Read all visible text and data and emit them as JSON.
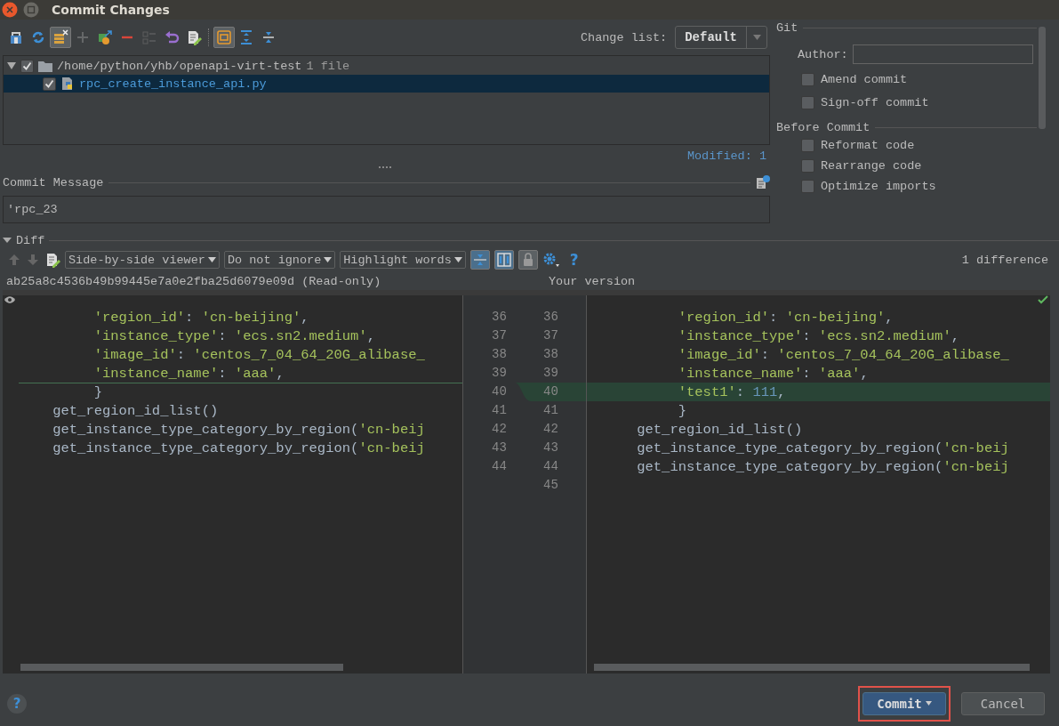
{
  "window": {
    "title": "Commit Changes"
  },
  "toolbar": [
    {
      "selected": false,
      "disabled": false
    },
    {
      "selected": false,
      "disabled": false
    },
    {
      "selected": true,
      "disabled": false
    },
    {
      "selected": false,
      "disabled": true
    },
    {
      "selected": false,
      "disabled": false
    },
    {
      "selected": false,
      "disabled": false
    },
    {
      "selected": false,
      "disabled": true
    },
    {
      "selected": false,
      "disabled": false
    },
    {
      "selected": false,
      "disabled": false
    },
    {
      "selected": true,
      "disabled": false
    },
    {
      "selected": false,
      "disabled": false
    },
    {
      "selected": false,
      "disabled": false
    }
  ],
  "change_list": {
    "label": "Change list:",
    "value": "Default"
  },
  "tree": [
    {
      "label": "/home/python/yhb/openapi-virt-test",
      "count": "1 file",
      "checked": true,
      "expanded": true,
      "selected": false,
      "children": [
        {
          "label": "rpc_create_instance_api.py",
          "checked": true,
          "selected": true
        }
      ]
    }
  ],
  "modified": "Modified: 1",
  "commit_message": {
    "label": "Commit Message",
    "value": "'rpc_23"
  },
  "git": {
    "title": "Git",
    "author_label": "Author:",
    "options": [
      {
        "label": "Amend commit",
        "checked": false
      },
      {
        "label": "Sign-off commit",
        "checked": false
      }
    ]
  },
  "before_commit": {
    "title": "Before Commit",
    "options": [
      {
        "label": "Reformat code",
        "checked": false
      },
      {
        "label": "Rearrange code",
        "checked": false
      },
      {
        "label": "Optimize imports",
        "checked": false
      }
    ]
  },
  "diff": {
    "title": "Diff",
    "expanded": true,
    "viewer": "Side-by-side viewer",
    "ignore": "Do not ignore",
    "highlight": "Highlight words",
    "toggles": [
      {
        "selected": true
      },
      {
        "selected": true
      },
      {
        "selected": false
      }
    ],
    "help": "?",
    "summary": "1 difference",
    "left_title": "ab25a8c4536b49b99445e7a0e2fba25d6079e09d (Read-only)",
    "right_title": "Your version",
    "left_lines": [
      {
        "number": "36",
        "kind": "plain",
        "code": [
          {
            "text": "         'region_id'",
            "kind": "str"
          },
          {
            "text": ": ",
            "kind": "txt"
          },
          {
            "text": "'cn-beijing'",
            "kind": "str"
          },
          {
            "text": ",",
            "kind": "txt"
          }
        ]
      },
      {
        "number": "37",
        "kind": "plain",
        "code": [
          {
            "text": "         'instance_type'",
            "kind": "str"
          },
          {
            "text": ": ",
            "kind": "txt"
          },
          {
            "text": "'ecs.sn2.medium'",
            "kind": "str"
          },
          {
            "text": ",",
            "kind": "txt"
          }
        ]
      },
      {
        "number": "38",
        "kind": "plain",
        "code": [
          {
            "text": "         'image_id'",
            "kind": "str"
          },
          {
            "text": ": ",
            "kind": "txt"
          },
          {
            "text": "'centos_7_04_64_20G_alibase_",
            "kind": "str"
          }
        ]
      },
      {
        "number": "39",
        "kind": "insertion-after",
        "code": [
          {
            "text": "         'instance_name'",
            "kind": "str"
          },
          {
            "text": ": ",
            "kind": "txt"
          },
          {
            "text": "'aaa'",
            "kind": "str"
          },
          {
            "text": ",",
            "kind": "txt"
          }
        ]
      },
      {
        "number": "40",
        "kind": "plain",
        "code": [
          {
            "text": "         }",
            "kind": "txt"
          }
        ]
      },
      {
        "number": "41",
        "kind": "plain",
        "code": [
          {
            "text": "    get_region_id_list()",
            "kind": "txt"
          }
        ]
      },
      {
        "number": "42",
        "kind": "plain",
        "code": [
          {
            "text": "    get_instance_type_category_by_region(",
            "kind": "txt"
          },
          {
            "text": "'cn-beij",
            "kind": "str"
          }
        ]
      },
      {
        "number": "43",
        "kind": "plain",
        "code": [
          {
            "text": "    get_instance_type_category_by_region(",
            "kind": "txt"
          },
          {
            "text": "'cn-beij",
            "kind": "str"
          }
        ]
      },
      {
        "number": "44",
        "kind": "plain"
      }
    ],
    "right_lines": [
      {
        "number": "36",
        "kind": "plain",
        "code": [
          {
            "text": "         'region_id'",
            "kind": "str"
          },
          {
            "text": ": ",
            "kind": "txt"
          },
          {
            "text": "'cn-beijing'",
            "kind": "str"
          },
          {
            "text": ",",
            "kind": "txt"
          }
        ]
      },
      {
        "number": "37",
        "kind": "plain",
        "code": [
          {
            "text": "         'instance_type'",
            "kind": "str"
          },
          {
            "text": ": ",
            "kind": "txt"
          },
          {
            "text": "'ecs.sn2.medium'",
            "kind": "str"
          },
          {
            "text": ",",
            "kind": "txt"
          }
        ]
      },
      {
        "number": "38",
        "kind": "plain",
        "code": [
          {
            "text": "         'image_id'",
            "kind": "str"
          },
          {
            "text": ": ",
            "kind": "txt"
          },
          {
            "text": "'centos_7_04_64_20G_alibase_",
            "kind": "str"
          }
        ]
      },
      {
        "number": "39",
        "kind": "plain",
        "code": [
          {
            "text": "         'instance_name'",
            "kind": "str"
          },
          {
            "text": ": ",
            "kind": "txt"
          },
          {
            "text": "'aaa'",
            "kind": "str"
          },
          {
            "text": ",",
            "kind": "txt"
          }
        ]
      },
      {
        "number": "40",
        "kind": "added",
        "code": [
          {
            "text": "         'test1'",
            "kind": "str"
          },
          {
            "text": ": ",
            "kind": "txt"
          },
          {
            "text": "111",
            "kind": "num"
          },
          {
            "text": ",",
            "kind": "txt"
          }
        ]
      },
      {
        "number": "41",
        "kind": "plain",
        "code": [
          {
            "text": "         }",
            "kind": "txt"
          }
        ]
      },
      {
        "number": "42",
        "kind": "plain",
        "code": [
          {
            "text": "    get_region_id_list()",
            "kind": "txt"
          }
        ]
      },
      {
        "number": "43",
        "kind": "plain",
        "code": [
          {
            "text": "    get_instance_type_category_by_region(",
            "kind": "txt"
          },
          {
            "text": "'cn-beij",
            "kind": "str"
          }
        ]
      },
      {
        "number": "44",
        "kind": "plain",
        "code": [
          {
            "text": "    get_instance_type_category_by_region(",
            "kind": "txt"
          },
          {
            "text": "'cn-beij",
            "kind": "str"
          }
        ]
      },
      {
        "number": "45",
        "kind": "plain"
      }
    ]
  },
  "help": "?",
  "buttons": [
    {
      "label": "Commit",
      "kind": "primary",
      "highlighted": true
    },
    {
      "label": "Cancel",
      "kind": "default",
      "highlighted": false
    }
  ]
}
